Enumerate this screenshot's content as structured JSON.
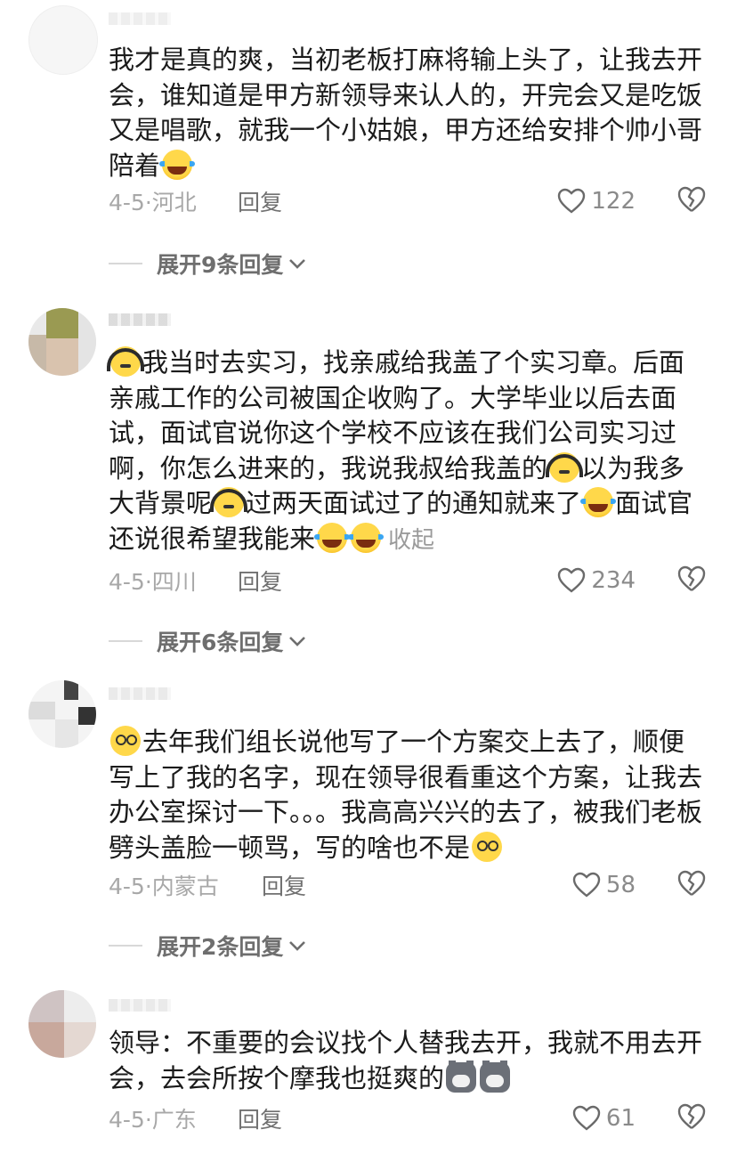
{
  "comments": [
    {
      "text_parts": [
        "我才是真的爽，当初老板打麻将输上头了，让我去开会，谁知道是甲方新领导来认人的，开完会又是吃饭又是唱歌，就我一个小姑娘，甲方还给安排个帅小哥陪着"
      ],
      "emojis": [
        "laugh-cry-emoji"
      ],
      "date": "4-5",
      "location": "河北",
      "reply_label": "回复",
      "likes": "122",
      "expand_label": "展开9条回复"
    },
    {
      "text_parts": [
        "我当时去实习，找亲戚给我盖了个实习章。后面亲戚工作的公司被国企收购了。大学毕业以后去面试，面试官说你这个学校不应该在我们公司实习过啊，你怎么进来的，我说我叔给我盖的",
        "以为我多大背景呢",
        "过两天面试过了的通知就来了",
        "面试官还说很希望我能来"
      ],
      "collapse_label": "收起",
      "date": "4-5",
      "location": "四川",
      "reply_label": "回复",
      "likes": "234",
      "expand_label": "展开6条回复"
    },
    {
      "text_parts": [
        "去年我们组长说他写了一个方案交上去了，顺便写上了我的名字，现在领导很看重这个方案，让我去办公室探讨一下。。。我高高兴兴的去了，被我们老板劈头盖脸一顿骂，写的啥也不是"
      ],
      "date": "4-5",
      "location": "内蒙古",
      "reply_label": "回复",
      "likes": "58",
      "expand_label": "展开2条回复"
    },
    {
      "text_parts": [
        "领导：不重要的会议找个人替我去开，我就不用去开会，去会所按个摩我也挺爽的"
      ],
      "date": "4-5",
      "location": "广东",
      "reply_label": "回复",
      "likes": "61"
    }
  ],
  "separator": "·",
  "colors": {
    "text": "#1b1b1b",
    "meta": "#a8a8a8",
    "reply": "#707070",
    "expand": "#6e6e6e"
  }
}
